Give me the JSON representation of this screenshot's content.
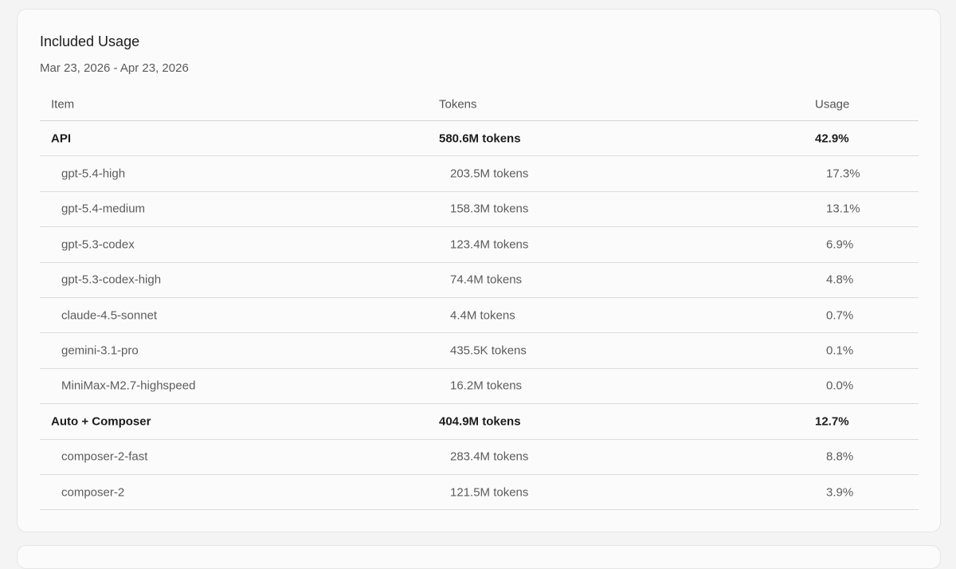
{
  "section": {
    "title": "Included Usage",
    "date_range": "Mar 23, 2026 - Apr 23, 2026"
  },
  "table": {
    "headers": {
      "item": "Item",
      "tokens": "Tokens",
      "usage": "Usage"
    },
    "rows": [
      {
        "type": "group",
        "item": "API",
        "tokens": "580.6M tokens",
        "usage": "42.9%"
      },
      {
        "type": "sub",
        "item": "gpt-5.4-high",
        "tokens": "203.5M tokens",
        "usage": "17.3%"
      },
      {
        "type": "sub",
        "item": "gpt-5.4-medium",
        "tokens": "158.3M tokens",
        "usage": "13.1%"
      },
      {
        "type": "sub",
        "item": "gpt-5.3-codex",
        "tokens": "123.4M tokens",
        "usage": "6.9%"
      },
      {
        "type": "sub",
        "item": "gpt-5.3-codex-high",
        "tokens": "74.4M tokens",
        "usage": "4.8%"
      },
      {
        "type": "sub",
        "item": "claude-4.5-sonnet",
        "tokens": "4.4M tokens",
        "usage": "0.7%"
      },
      {
        "type": "sub",
        "item": "gemini-3.1-pro",
        "tokens": "435.5K tokens",
        "usage": "0.1%"
      },
      {
        "type": "sub",
        "item": "MiniMax-M2.7-highspeed",
        "tokens": "16.2M tokens",
        "usage": "0.0%"
      },
      {
        "type": "group",
        "item": "Auto + Composer",
        "tokens": "404.9M tokens",
        "usage": "12.7%"
      },
      {
        "type": "sub",
        "item": "composer-2-fast",
        "tokens": "283.4M tokens",
        "usage": "8.8%"
      },
      {
        "type": "sub",
        "item": "composer-2",
        "tokens": "121.5M tokens",
        "usage": "3.9%"
      }
    ]
  }
}
